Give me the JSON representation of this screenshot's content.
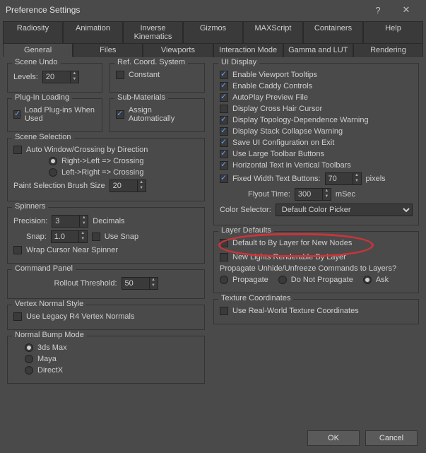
{
  "window": {
    "title": "Preference Settings"
  },
  "tabs_row1": [
    "Radiosity",
    "Animation",
    "Inverse Kinematics",
    "Gizmos",
    "MAXScript",
    "Containers",
    "Help"
  ],
  "tabs_row2": [
    "General",
    "Files",
    "Viewports",
    "Interaction Mode",
    "Gamma and LUT",
    "Rendering"
  ],
  "active_tab": "General",
  "left": {
    "scene_undo": {
      "legend": "Scene Undo",
      "levels_label": "Levels:",
      "levels": "20"
    },
    "ref_coord": {
      "legend": "Ref. Coord. System",
      "constant_label": "Constant",
      "constant": false
    },
    "plugin": {
      "legend": "Plug-In Loading",
      "load_label": "Load Plug-ins When Used",
      "load": true
    },
    "submat": {
      "legend": "Sub-Materials",
      "assign_label": "Assign Automatically",
      "assign": true
    },
    "scene_sel": {
      "legend": "Scene Selection",
      "auto_label": "Auto Window/Crossing by Direction",
      "auto": false,
      "opt1": "Right->Left => Crossing",
      "opt2": "Left->Right => Crossing",
      "paint_label": "Paint Selection Brush Size",
      "paint": "20"
    },
    "spinners": {
      "legend": "Spinners",
      "precision_label": "Precision:",
      "precision": "3",
      "decimals_label": "Decimals",
      "snap_label": "Snap:",
      "snap": "1.0",
      "use_snap_label": "Use Snap",
      "use_snap": false,
      "wrap_label": "Wrap Cursor Near Spinner",
      "wrap": false
    },
    "cmd_panel": {
      "legend": "Command Panel",
      "rollout_label": "Rollout Threshold:",
      "rollout": "50"
    },
    "vertex": {
      "legend": "Vertex Normal Style",
      "legacy_label": "Use Legacy R4 Vertex Normals",
      "legacy": false
    },
    "normal_bump": {
      "legend": "Normal Bump Mode",
      "opts": [
        "3ds Max",
        "Maya",
        "DirectX"
      ],
      "selected": "3ds Max"
    }
  },
  "right": {
    "ui_display": {
      "legend": "UI Display",
      "items": [
        {
          "label": "Enable Viewport Tooltips",
          "checked": true
        },
        {
          "label": "Enable Caddy Controls",
          "checked": true
        },
        {
          "label": "AutoPlay Preview File",
          "checked": true
        },
        {
          "label": "Display Cross Hair Cursor",
          "checked": false
        },
        {
          "label": "Display Topology-Dependence Warning",
          "checked": true
        },
        {
          "label": "Display Stack Collapse Warning",
          "checked": true
        },
        {
          "label": "Save UI Configuration on Exit",
          "checked": true
        },
        {
          "label": "Use Large Toolbar Buttons",
          "checked": true
        },
        {
          "label": "Horizontal Text in Vertical Toolbars",
          "checked": true
        }
      ],
      "fixed_label": "Fixed Width Text Buttons:",
      "fixed_checked": true,
      "fixed_val": "70",
      "pixels": "pixels",
      "flyout_label": "Flyout Time:",
      "flyout_val": "300",
      "msec": "mSec",
      "color_sel_label": "Color Selector:",
      "color_sel_val": "Default Color Picker"
    },
    "layer_defaults": {
      "legend": "Layer Defaults",
      "default_label": "Default to By Layer for New Nodes",
      "default": false,
      "lights_label": "New Lights Renderable By Layer",
      "lights": false,
      "propagate_q": "Propagate Unhide/Unfreeze Commands to Layers?",
      "opts": [
        "Propagate",
        "Do Not Propagate",
        "Ask"
      ],
      "selected": "Ask"
    },
    "texture": {
      "legend": "Texture Coordinates",
      "real_label": "Use Real-World Texture Coordinates",
      "real": false
    }
  },
  "footer": {
    "ok": "OK",
    "cancel": "Cancel"
  }
}
